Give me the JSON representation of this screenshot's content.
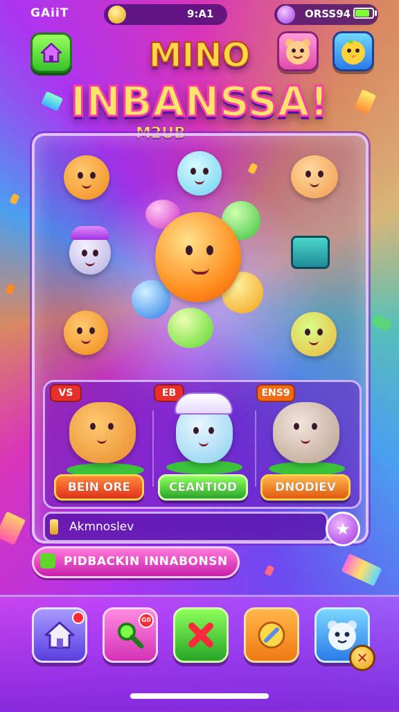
{
  "status": {
    "carrier": "GAiiT",
    "coins": "9:A1",
    "gems": "ORSS94",
    "battery_level": 0.8
  },
  "header": {
    "title_line1": "MINO",
    "title_line2": "INBANSSA!",
    "subtitle": "M2UB"
  },
  "characters": [
    {
      "tag": "VS",
      "button": "BEIN ORE",
      "tag_color": "#e8302a",
      "button_color": "#e0301c"
    },
    {
      "tag": "EB",
      "button": "CEANTIOD",
      "tag_color": "#e8302a",
      "button_color": "#2aa52a"
    },
    {
      "tag": "ENS9",
      "button": "DNODIEV",
      "tag_color": "#ef6a14",
      "button_color": "#e05a10"
    }
  ],
  "input": {
    "text": "Akmnoslev"
  },
  "banner": {
    "text": "PIDBACKIN INNABONSN"
  },
  "nav": {
    "badge_search": "G0"
  },
  "icons": {
    "home": "home-icon",
    "search": "search-icon",
    "close": "close-icon",
    "edit": "edit-icon",
    "star": "star-icon"
  }
}
